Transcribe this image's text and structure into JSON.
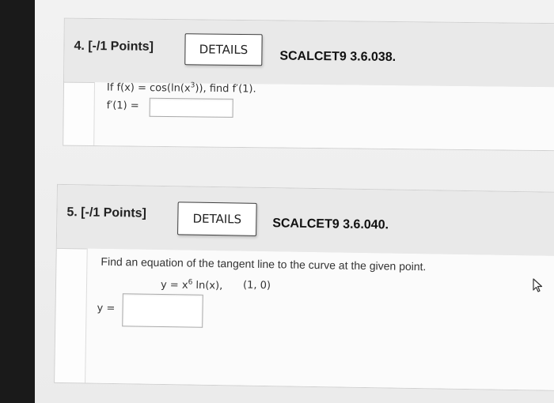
{
  "q4": {
    "label": "4. [-/1 Points]",
    "details": "DETAILS",
    "course": "SCALCET9 3.6.038.",
    "prompt_pre": "If f(x) = cos(ln(x",
    "prompt_sup": "3",
    "prompt_post": ")), find f′(1).",
    "answer_label": "f′(1) ="
  },
  "q5": {
    "label": "5. [-/1 Points]",
    "details": "DETAILS",
    "course": "SCALCET9 3.6.040.",
    "prompt": "Find an equation of the tangent line to the curve at the given point.",
    "eq_pre": "y = x",
    "eq_sup": "6",
    "eq_post": " ln(x),",
    "point": "(1, 0)",
    "answer_label": "y ="
  },
  "icons": {
    "cursor": "pointer-cursor-icon"
  }
}
